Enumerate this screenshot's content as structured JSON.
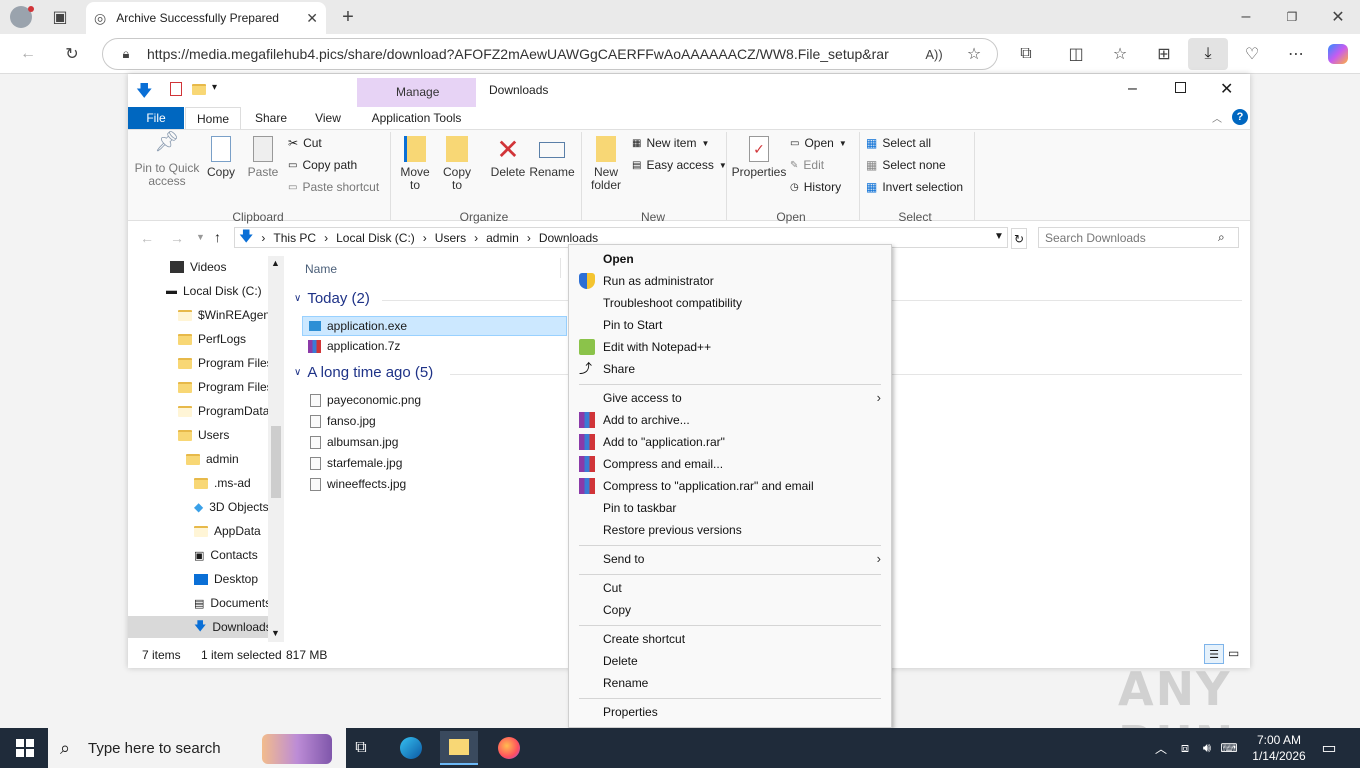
{
  "browser": {
    "tab_title": "Archive Successfully Prepared",
    "url": "https://media.megafilehub4.pics/share/download?AFOFZ2mAewUAWGgCAERFFwAoAAAAAACZ/WW8.File_setup&rar"
  },
  "explorer": {
    "window_title": "Downloads",
    "context_tab": "Manage",
    "tabs": [
      "File",
      "Home",
      "Share",
      "View",
      "Application Tools"
    ],
    "ribbon": {
      "pin": "Pin to Quick access",
      "copy": "Copy",
      "paste": "Paste",
      "cut": "Cut",
      "copy_path": "Copy path",
      "paste_shortcut": "Paste shortcut",
      "move_to": "Move to",
      "copy_to": "Copy to",
      "delete": "Delete",
      "rename": "Rename",
      "new_folder": "New folder",
      "new_item": "New item",
      "easy_access": "Easy access",
      "properties": "Properties",
      "open": "Open",
      "edit": "Edit",
      "history": "History",
      "select_all": "Select all",
      "select_none": "Select none",
      "invert_selection": "Invert selection",
      "groups": [
        "Clipboard",
        "Organize",
        "New",
        "Open",
        "Select"
      ]
    },
    "breadcrumb": [
      "This PC",
      "Local Disk (C:)",
      "Users",
      "admin",
      "Downloads"
    ],
    "search_placeholder": "Search Downloads",
    "nav": [
      "Videos",
      "Local Disk (C:)",
      "$WinREAgent",
      "PerfLogs",
      "Program Files",
      "Program Files",
      "ProgramData",
      "Users",
      "admin",
      ".ms-ad",
      "3D Objects",
      "AppData",
      "Contacts",
      "Desktop",
      "Documents",
      "Downloads"
    ],
    "column_name": "Name",
    "groups": [
      {
        "label": "Today (2)",
        "files": [
          "application.exe",
          "application.7z"
        ]
      },
      {
        "label": "A long time ago (5)",
        "files": [
          "payeconomic.png",
          "fanso.jpg",
          "albumsan.jpg",
          "starfemale.jpg",
          "wineeffects.jpg"
        ]
      }
    ],
    "status": {
      "items": "7 items",
      "selected": "1 item selected",
      "size": "817 MB"
    }
  },
  "context_menu": {
    "open": "Open",
    "run_admin": "Run as administrator",
    "troubleshoot": "Troubleshoot compatibility",
    "pin_start": "Pin to Start",
    "edit_notepad": "Edit with Notepad++",
    "share": "Share",
    "give_access": "Give access to",
    "add_archive": "Add to archive...",
    "add_rar": "Add to \"application.rar\"",
    "compress_email": "Compress and email...",
    "compress_rar_email": "Compress to \"application.rar\" and email",
    "pin_taskbar": "Pin to taskbar",
    "restore": "Restore previous versions",
    "send_to": "Send to",
    "cut": "Cut",
    "copy": "Copy",
    "create_shortcut": "Create shortcut",
    "delete": "Delete",
    "rename": "Rename",
    "properties": "Properties"
  },
  "taskbar": {
    "search_placeholder": "Type here to search",
    "time": "7:00 AM",
    "date": "1/14/2026"
  },
  "watermark": "ANY RUN",
  "colors": {
    "accent": "#0067c0",
    "selection": "#cce8ff",
    "taskbar": "#1f2b3a",
    "manage_tab": "#e7d3f5"
  }
}
